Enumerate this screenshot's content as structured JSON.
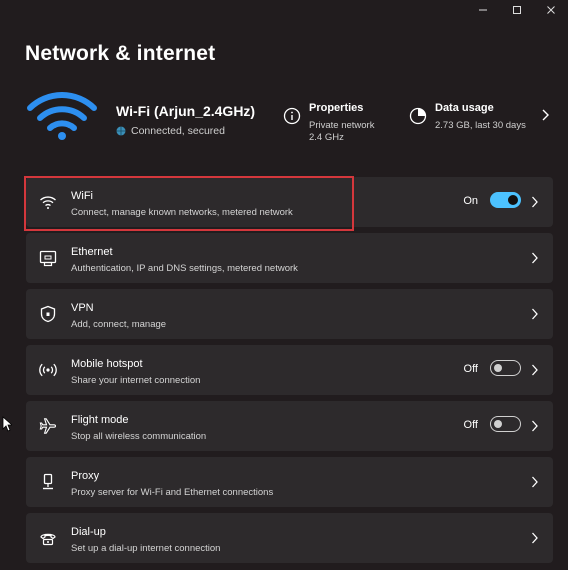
{
  "window": {
    "controls": [
      "minimize",
      "maximize",
      "close"
    ]
  },
  "page": {
    "title": "Network & internet"
  },
  "hero": {
    "network_name": "Wi-Fi (Arjun_2.4GHz)",
    "status": "Connected, secured",
    "properties": {
      "title": "Properties",
      "line1": "Private network",
      "line2": "2.4 GHz"
    },
    "data_usage": {
      "title": "Data usage",
      "value": "2.73 GB, last 30 days"
    }
  },
  "items": [
    {
      "key": "wifi",
      "icon": "wifi-icon",
      "title": "WiFi",
      "subtitle": "Connect, manage known networks, metered network",
      "toggle": true,
      "state": "On"
    },
    {
      "key": "ethernet",
      "icon": "ethernet-icon",
      "title": "Ethernet",
      "subtitle": "Authentication, IP and DNS settings, metered network"
    },
    {
      "key": "vpn",
      "icon": "shield-icon",
      "title": "VPN",
      "subtitle": "Add, connect, manage"
    },
    {
      "key": "mobile-hotspot",
      "icon": "hotspot-icon",
      "title": "Mobile hotspot",
      "subtitle": "Share your internet connection",
      "toggle": false,
      "state": "Off"
    },
    {
      "key": "flight-mode",
      "icon": "airplane-icon",
      "title": "Flight mode",
      "subtitle": "Stop all wireless communication",
      "toggle": false,
      "state": "Off"
    },
    {
      "key": "proxy",
      "icon": "proxy-icon",
      "title": "Proxy",
      "subtitle": "Proxy server for Wi-Fi and Ethernet connections"
    },
    {
      "key": "dial-up",
      "icon": "dialup-icon",
      "title": "Dial-up",
      "subtitle": "Set up a dial-up internet connection"
    }
  ],
  "colors": {
    "accent": "#4cc2ff",
    "background": "#211c1e",
    "card": "#2d2a2c",
    "highlight": "#d4373c"
  }
}
